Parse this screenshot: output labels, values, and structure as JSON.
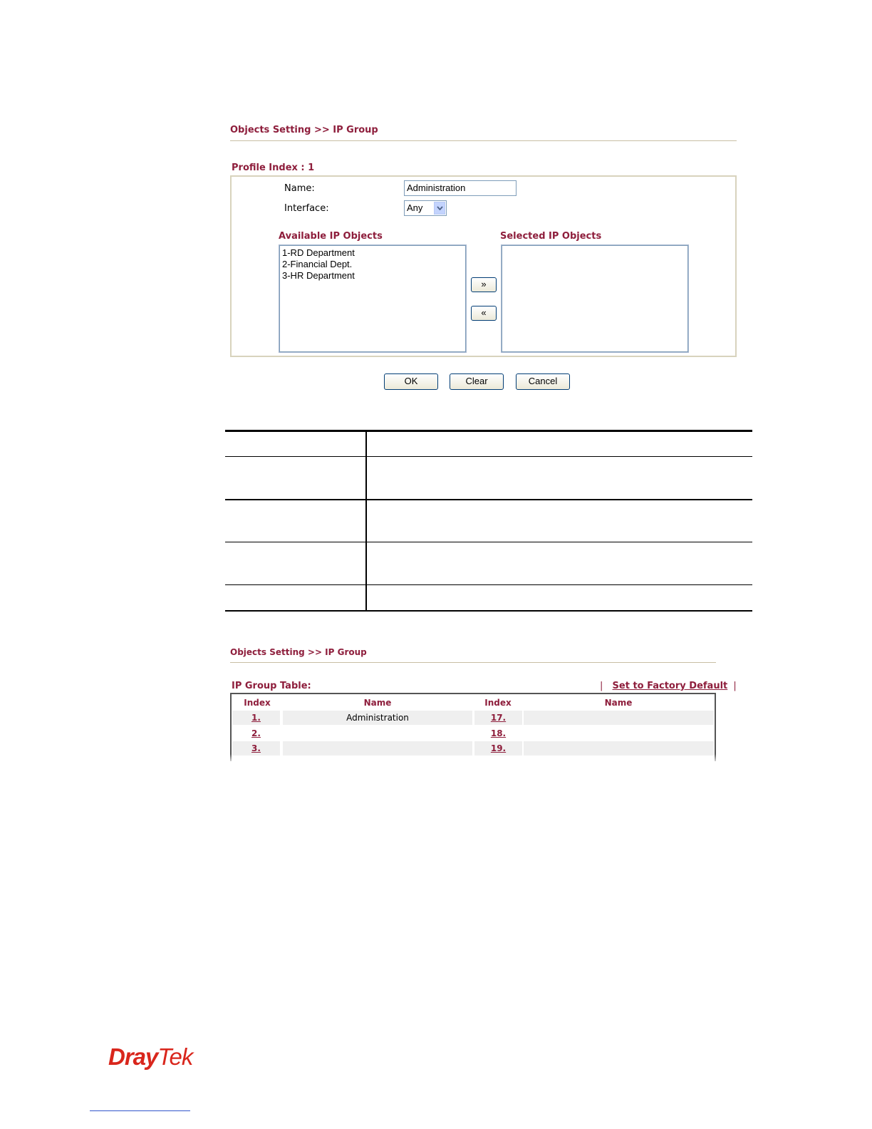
{
  "screen1": {
    "breadcrumb": "Objects Setting >> IP Group",
    "profile_index": "Profile Index : 1",
    "name_label": "Name:",
    "name_value": "Administration",
    "interface_label": "Interface:",
    "interface_value": "Any",
    "available_title": "Available IP Objects",
    "selected_title": "Selected IP Objects",
    "available_items": [
      "1-RD Department",
      "2-Financial Dept.",
      "3-HR Department"
    ],
    "add_button": "»",
    "remove_button": "«",
    "ok_button": "OK",
    "clear_button": "Clear",
    "cancel_button": "Cancel"
  },
  "screen2": {
    "breadcrumb": "Objects Setting >> IP Group",
    "table_title": "IP Group Table:",
    "sep_left": "|",
    "factory_default": "Set to Factory Default",
    "sep_right": "|",
    "headers": [
      "Index",
      "Name",
      "Index",
      "Name"
    ],
    "rows": [
      {
        "left_index": "1.",
        "left_name": "Administration",
        "right_index": "17.",
        "right_name": ""
      },
      {
        "left_index": "2.",
        "left_name": "",
        "right_index": "18.",
        "right_name": ""
      },
      {
        "left_index": "3.",
        "left_name": "",
        "right_index": "19.",
        "right_name": ""
      }
    ]
  },
  "footer": {
    "logo_text_dray": "Dray",
    "logo_text_tek": "Tek",
    "logo_color": "#d9261c"
  }
}
